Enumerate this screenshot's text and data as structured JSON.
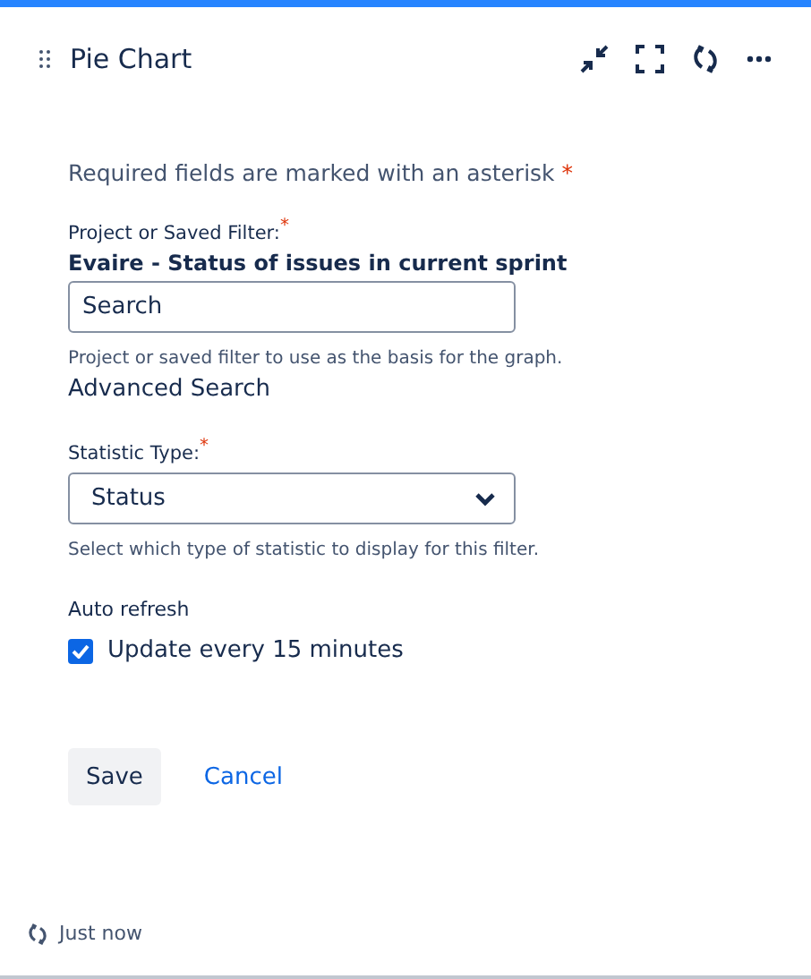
{
  "header": {
    "title": "Pie Chart"
  },
  "required_note": {
    "text": "Required fields are marked with an asterisk",
    "mark": "*"
  },
  "filter": {
    "label": "Project or Saved Filter:",
    "required": true,
    "mark": "*",
    "selected_filter": "Evaire - Status of issues in current sprint",
    "placeholder": "Search",
    "help": "Project or saved filter to use as the basis for the graph.",
    "link": "Advanced Search"
  },
  "statistic": {
    "label": "Statistic Type:",
    "required": true,
    "mark": "*",
    "value": "Status",
    "help": "Select which type of statistic to display for this filter."
  },
  "auto_refresh": {
    "label": "Auto refresh",
    "option": "Update every 15 minutes",
    "checked": true
  },
  "buttons": {
    "save": "Save",
    "cancel": "Cancel"
  },
  "footer": {
    "updated": "Just now"
  }
}
